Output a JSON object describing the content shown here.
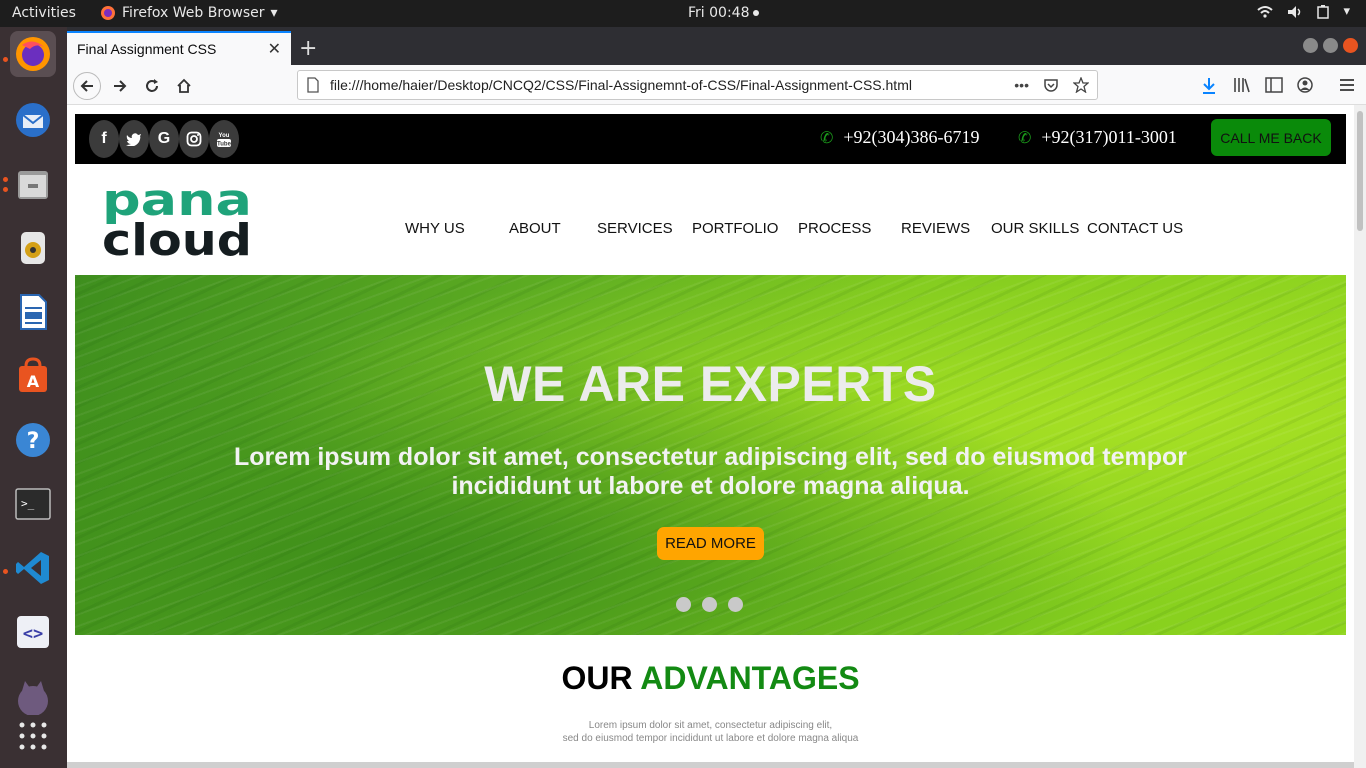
{
  "system_bar": {
    "activities": "Activities",
    "app_name": "Firefox Web Browser",
    "clock": "Fri 00:48"
  },
  "browser": {
    "tab_title": "Final Assignment CSS",
    "url": "file:///home/haier/Desktop/CNCQ2/CSS/Final-Assignemnt-of-CSS/Final-Assignment-CSS.html"
  },
  "page": {
    "phones": [
      "+92(304)386-6719",
      "+92(317)011-3001"
    ],
    "call_button": "CALL ME BACK",
    "logo_top": "pana",
    "logo_bottom": "cloud",
    "menu": [
      "WHY US",
      "ABOUT",
      "SERVICES",
      "PORTFOLIO",
      "PROCESS",
      "REVIEWS",
      "OUR SKILLS",
      "CONTACT US"
    ],
    "hero": {
      "title": "WE ARE EXPERTS",
      "text": "Lorem ipsum dolor sit amet, consectetur adipiscing elit, sed do eiusmod tempor incididunt ut labore et dolore magna aliqua.",
      "button": "READ MORE"
    },
    "advantages": {
      "title_part1": "OUR",
      "title_part2": "ADVANTAGES",
      "line1": "Lorem ipsum dolor sit amet, consectetur adipiscing elit,",
      "line2": "sed do eiusmod tempor incididunt ut labore et dolore magna aliqua"
    }
  },
  "colors": {
    "accent_green": "#138a13",
    "call_button": "#0a8a0a",
    "read_more": "#ffa500"
  }
}
